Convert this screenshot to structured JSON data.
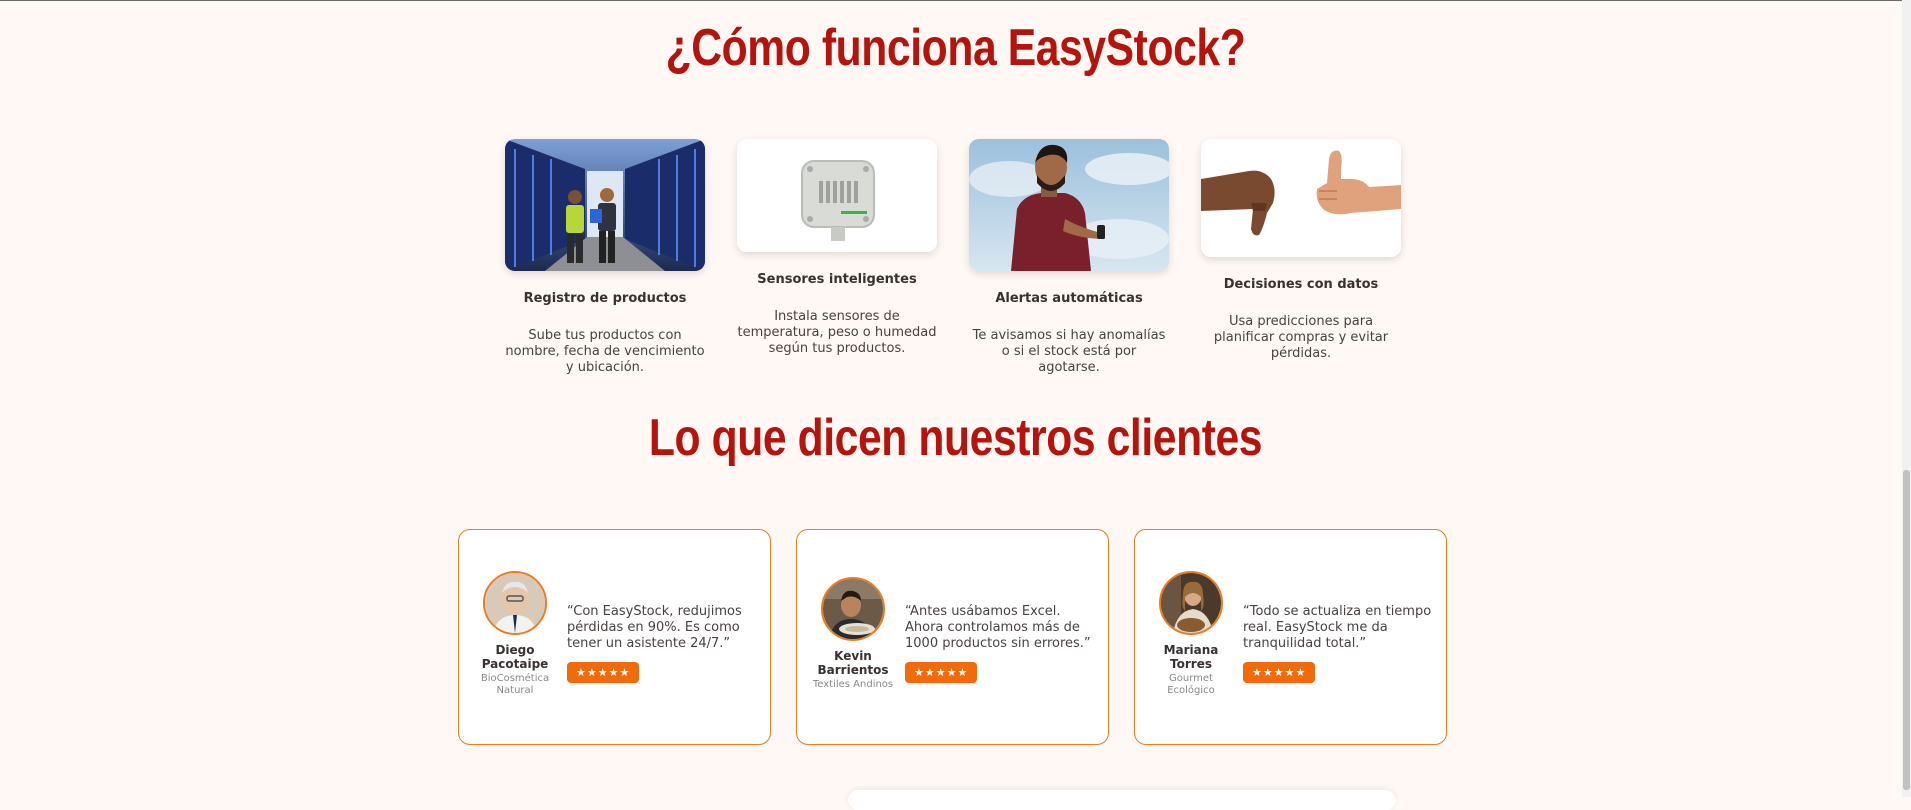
{
  "how": {
    "title": "¿Cómo funciona EasyStock?",
    "steps": [
      {
        "title": "Registro de productos",
        "description": "Sube tus productos con nombre, fecha de vencimiento y ubicación."
      },
      {
        "title": "Sensores inteligentes",
        "description": "Instala sensores de temperatura, peso o humedad según tus productos."
      },
      {
        "title": "Alertas automáticas",
        "description": "Te avisamos si hay anomalías o si el stock está por agotarse."
      },
      {
        "title": "Decisiones con datos",
        "description": "Usa predicciones para planificar compras y evitar pérdidas."
      }
    ]
  },
  "testimonials": {
    "title": "Lo que dicen nuestros clientes",
    "items": [
      {
        "name": "Diego Pacotaipe",
        "company": "BioCosmética Natural",
        "quote": "“Con EasyStock, redujimos pérdidas en 90%. Es como tener un asistente 24/7.”",
        "stars": "★★★★★",
        "rating": 5
      },
      {
        "name": "Kevin Barrientos",
        "company": "Textiles Andinos",
        "quote": "“Antes usábamos Excel. Ahora controlamos más de 1000 productos sin errores.”",
        "stars": "★★★★★",
        "rating": 5
      },
      {
        "name": "Mariana Torres",
        "company": "Gourmet Ecológico",
        "quote": "“Todo se actualiza en tiempo real. EasyStock me da tranquilidad total.”",
        "stars": "★★★★★",
        "rating": 5
      }
    ]
  },
  "colors": {
    "heading": "#b5140c",
    "accent": "#f07a1e",
    "stars_bg": "#f26b0a",
    "background": "#fff8f4"
  }
}
